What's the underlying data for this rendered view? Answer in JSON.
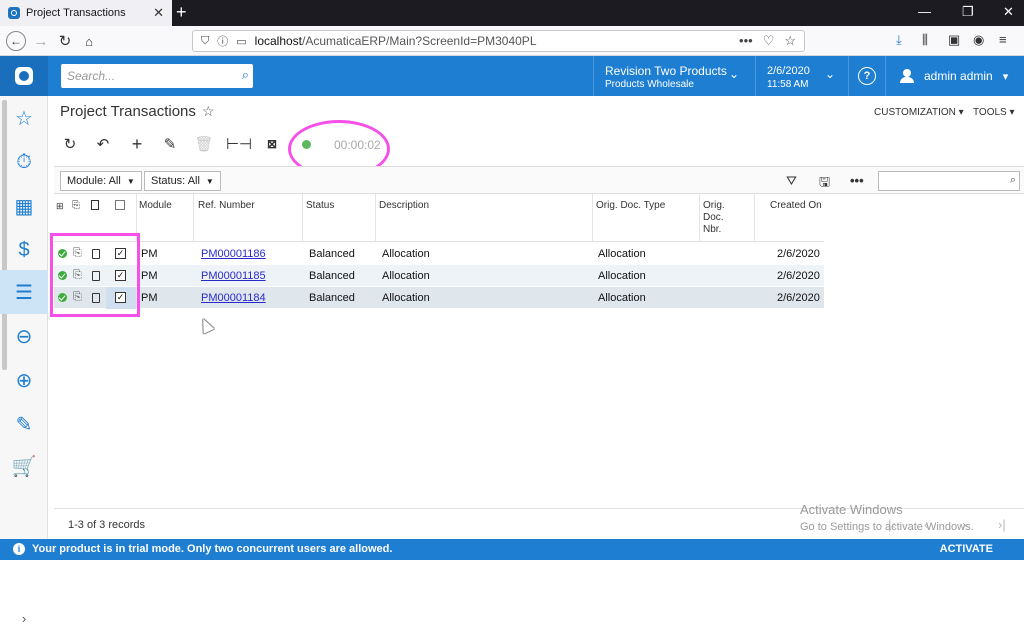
{
  "browser": {
    "tab_title": "Project Transactions",
    "tab_close": "✕",
    "new_tab": "+",
    "url_host": "localhost",
    "url_path": "/AcumaticaERP/Main?ScreenId=PM3040PL",
    "url_more": "•••"
  },
  "header": {
    "search_placeholder": "Search...",
    "branch_line1": "Revision Two Products",
    "branch_line2": "Products Wholesale",
    "date_line1": "2/6/2020",
    "date_line2": "11:58 AM",
    "help": "?",
    "user": "admin admin"
  },
  "page": {
    "title": "Project Transactions",
    "customization": "CUSTOMIZATION ▾",
    "tools": "TOOLS ▾",
    "timer": "00:00:02"
  },
  "filters": {
    "module": "Module: All",
    "status": "Status: All"
  },
  "table": {
    "columns": {
      "module": "Module",
      "ref": "Ref. Number",
      "status": "Status",
      "description": "Description",
      "orig_type": "Orig. Doc. Type",
      "orig_nbr": "Orig. Doc. Nbr.",
      "created": "Created On"
    },
    "rows": [
      {
        "module": "PM",
        "ref": "PM00001186",
        "status": "Balanced",
        "description": "Allocation",
        "orig_type": "Allocation",
        "created": "2/6/2020"
      },
      {
        "module": "PM",
        "ref": "PM00001185",
        "status": "Balanced",
        "description": "Allocation",
        "orig_type": "Allocation",
        "created": "2/6/2020"
      },
      {
        "module": "PM",
        "ref": "PM00001184",
        "status": "Balanced",
        "description": "Allocation",
        "orig_type": "Allocation",
        "created": "2/6/2020"
      }
    ]
  },
  "footer": {
    "records": "1-3 of 3 records",
    "watermark_title": "Activate Windows",
    "watermark_sub": "Go to Settings to activate Windows."
  },
  "trial": {
    "message": "Your product is in trial mode. Only two concurrent users are allowed.",
    "action": "ACTIVATE"
  },
  "colors": {
    "brand": "#1e7ed2",
    "highlight": "#f550e8",
    "ok": "#3cab3c"
  }
}
